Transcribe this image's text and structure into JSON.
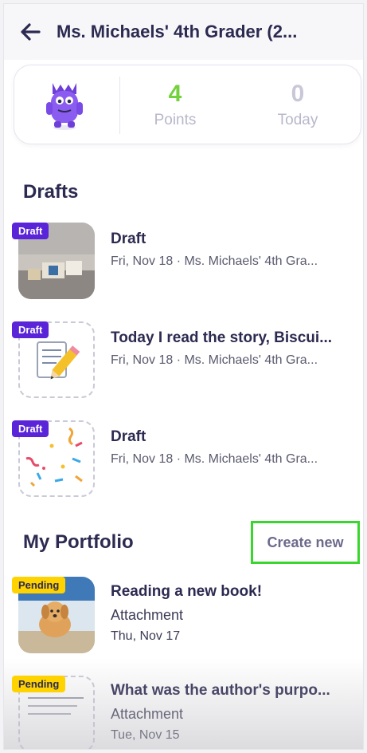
{
  "header": {
    "title": "Ms. Michaels' 4th Grader (2..."
  },
  "stats": {
    "points_value": "4",
    "points_label": "Points",
    "today_value": "0",
    "today_label": "Today"
  },
  "drafts": {
    "title": "Drafts",
    "items": [
      {
        "badge": "Draft",
        "title": "Draft",
        "subtitle": "Fri, Nov 18 · Ms. Michaels' 4th Gra..."
      },
      {
        "badge": "Draft",
        "title": "Today I read the story, Biscui...",
        "subtitle": "Fri, Nov 18 · Ms. Michaels' 4th Gra..."
      },
      {
        "badge": "Draft",
        "title": "Draft",
        "subtitle": "Fri, Nov 18 · Ms. Michaels' 4th Gra..."
      }
    ]
  },
  "portfolio": {
    "title": "My Portfolio",
    "create_label": "Create new",
    "items": [
      {
        "badge": "Pending",
        "title": "Reading a new book!",
        "type": "Attachment",
        "date": "Thu, Nov 17"
      },
      {
        "badge": "Pending",
        "title": "What was the author's purpo...",
        "type": "Attachment",
        "date": "Tue, Nov 15"
      }
    ]
  },
  "colors": {
    "title_text": "#2c2a50",
    "points_green": "#72d13d",
    "draft_badge": "#5a24d8",
    "pending_badge": "#ffd300",
    "highlight_border": "#3ad62d"
  },
  "icons": {
    "back": "arrow-left-icon",
    "avatar": "monster-avatar-icon"
  }
}
